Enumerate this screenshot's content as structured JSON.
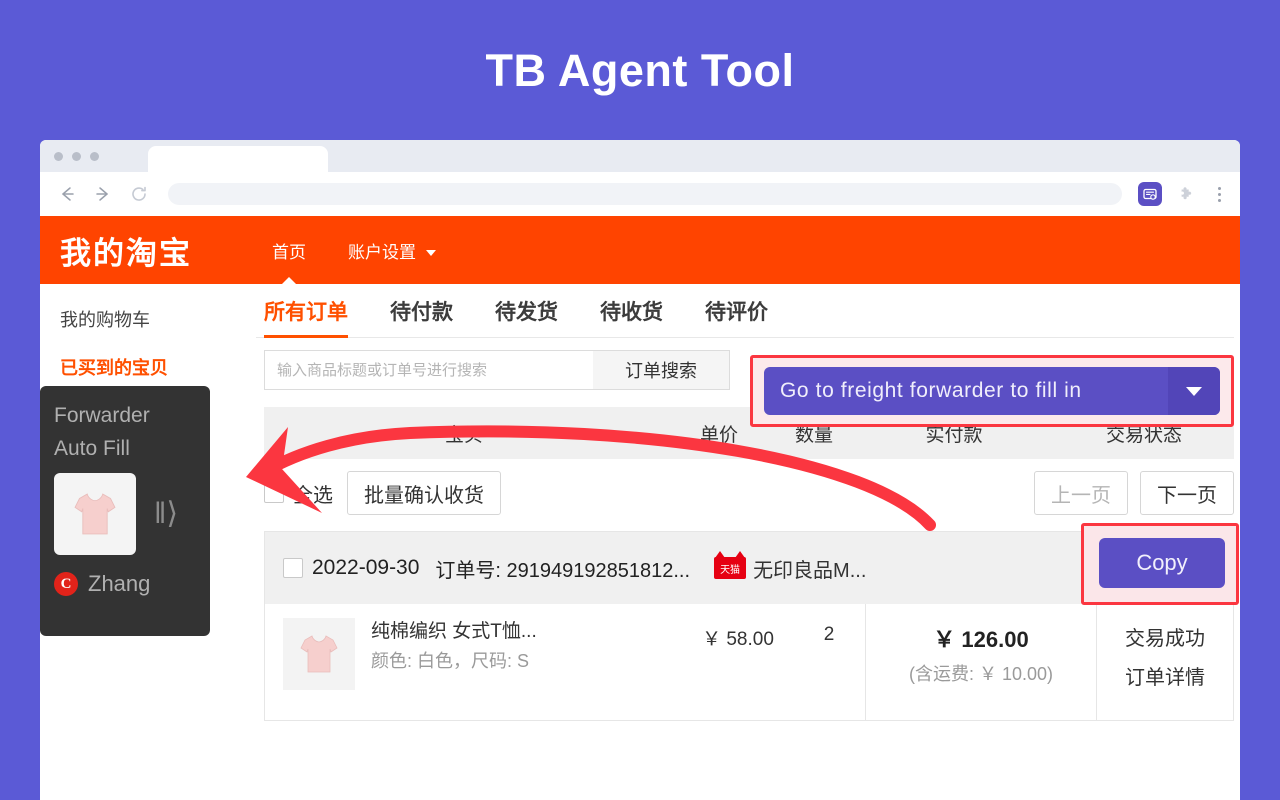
{
  "page": {
    "title": "TB Agent Tool",
    "background_color": "#5b5ad6"
  },
  "browser": {
    "tab_title": "",
    "url_value": "",
    "url_placeholder": "",
    "back_icon": "←",
    "forward_icon": "→",
    "reload_icon": "↻",
    "extension_icon": "extension-icon",
    "puzzle_icon": "❖",
    "menu_icon": "kebab-menu-icon"
  },
  "site_header": {
    "logo": "我的淘宝",
    "nav": [
      {
        "label": "首页",
        "active": true
      },
      {
        "label": "账户设置",
        "active": false,
        "has_caret": true
      }
    ],
    "background_color": "#ff4400"
  },
  "sidebar": {
    "items": [
      {
        "label": "我的购物车",
        "active": false
      },
      {
        "label": "已买到的宝贝",
        "active": true
      }
    ]
  },
  "tabs": [
    {
      "label": "所有订单",
      "active": true
    },
    {
      "label": "待付款",
      "active": false
    },
    {
      "label": "待发货",
      "active": false
    },
    {
      "label": "待收货",
      "active": false
    },
    {
      "label": "待评价",
      "active": false
    }
  ],
  "search": {
    "placeholder": "输入商品标题或订单号进行搜索",
    "value": "",
    "button_label": "订单搜索"
  },
  "forwarder_dropdown": {
    "label": "Go to freight forwarder to fill in",
    "caret_icon": "chevron-down-icon",
    "button_color": "#5b4fc4",
    "highlight_border_color": "#fb3640"
  },
  "table": {
    "headers": {
      "goods": "宝贝",
      "price": "单价",
      "qty": "数量",
      "paid": "实付款",
      "state": "交易状态"
    }
  },
  "actions": {
    "select_all_label": "全选",
    "batch_confirm_label": "批量确认收货",
    "prev_page_label": "上一页",
    "next_page_label": "下一页"
  },
  "order": {
    "date": "2022-09-30",
    "order_no_label": "订单号: 291949192851812...",
    "shop_badge": "天猫",
    "shop_name": "无印良品M...",
    "copy_label": "Copy",
    "item": {
      "title": "纯棉编织 女式T恤...",
      "sku": "颜色: 白色，尺码: S",
      "unit_price": "￥ 58.00",
      "qty": "2",
      "paid_total": "￥ 126.00",
      "paid_shipping": "(含运费: ￥ 10.00)",
      "state": "交易成功",
      "detail_link": "订单详情"
    }
  },
  "overlay_panel": {
    "line1": "Forwarder",
    "line2": "Auto Fill",
    "expand_icon": "‖⟩",
    "avatar_letter": "C",
    "user_name": "Zhang",
    "background_color": "#333333"
  },
  "annotation": {
    "arrow_color": "#fb3640"
  }
}
